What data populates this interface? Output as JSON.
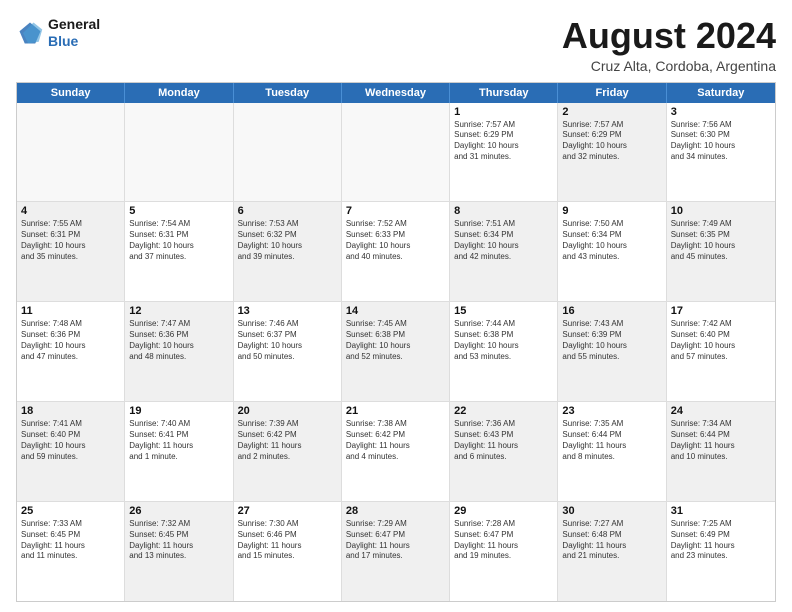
{
  "header": {
    "logo_line1": "General",
    "logo_line2": "Blue",
    "month_year": "August 2024",
    "location": "Cruz Alta, Cordoba, Argentina"
  },
  "weekdays": [
    "Sunday",
    "Monday",
    "Tuesday",
    "Wednesday",
    "Thursday",
    "Friday",
    "Saturday"
  ],
  "rows": [
    [
      {
        "day": "",
        "text": "",
        "shaded": false,
        "empty": true
      },
      {
        "day": "",
        "text": "",
        "shaded": false,
        "empty": true
      },
      {
        "day": "",
        "text": "",
        "shaded": false,
        "empty": true
      },
      {
        "day": "",
        "text": "",
        "shaded": false,
        "empty": true
      },
      {
        "day": "1",
        "text": "Sunrise: 7:57 AM\nSunset: 6:29 PM\nDaylight: 10 hours\nand 31 minutes.",
        "shaded": false,
        "empty": false
      },
      {
        "day": "2",
        "text": "Sunrise: 7:57 AM\nSunset: 6:29 PM\nDaylight: 10 hours\nand 32 minutes.",
        "shaded": true,
        "empty": false
      },
      {
        "day": "3",
        "text": "Sunrise: 7:56 AM\nSunset: 6:30 PM\nDaylight: 10 hours\nand 34 minutes.",
        "shaded": false,
        "empty": false
      }
    ],
    [
      {
        "day": "4",
        "text": "Sunrise: 7:55 AM\nSunset: 6:31 PM\nDaylight: 10 hours\nand 35 minutes.",
        "shaded": true,
        "empty": false
      },
      {
        "day": "5",
        "text": "Sunrise: 7:54 AM\nSunset: 6:31 PM\nDaylight: 10 hours\nand 37 minutes.",
        "shaded": false,
        "empty": false
      },
      {
        "day": "6",
        "text": "Sunrise: 7:53 AM\nSunset: 6:32 PM\nDaylight: 10 hours\nand 39 minutes.",
        "shaded": true,
        "empty": false
      },
      {
        "day": "7",
        "text": "Sunrise: 7:52 AM\nSunset: 6:33 PM\nDaylight: 10 hours\nand 40 minutes.",
        "shaded": false,
        "empty": false
      },
      {
        "day": "8",
        "text": "Sunrise: 7:51 AM\nSunset: 6:34 PM\nDaylight: 10 hours\nand 42 minutes.",
        "shaded": true,
        "empty": false
      },
      {
        "day": "9",
        "text": "Sunrise: 7:50 AM\nSunset: 6:34 PM\nDaylight: 10 hours\nand 43 minutes.",
        "shaded": false,
        "empty": false
      },
      {
        "day": "10",
        "text": "Sunrise: 7:49 AM\nSunset: 6:35 PM\nDaylight: 10 hours\nand 45 minutes.",
        "shaded": true,
        "empty": false
      }
    ],
    [
      {
        "day": "11",
        "text": "Sunrise: 7:48 AM\nSunset: 6:36 PM\nDaylight: 10 hours\nand 47 minutes.",
        "shaded": false,
        "empty": false
      },
      {
        "day": "12",
        "text": "Sunrise: 7:47 AM\nSunset: 6:36 PM\nDaylight: 10 hours\nand 48 minutes.",
        "shaded": true,
        "empty": false
      },
      {
        "day": "13",
        "text": "Sunrise: 7:46 AM\nSunset: 6:37 PM\nDaylight: 10 hours\nand 50 minutes.",
        "shaded": false,
        "empty": false
      },
      {
        "day": "14",
        "text": "Sunrise: 7:45 AM\nSunset: 6:38 PM\nDaylight: 10 hours\nand 52 minutes.",
        "shaded": true,
        "empty": false
      },
      {
        "day": "15",
        "text": "Sunrise: 7:44 AM\nSunset: 6:38 PM\nDaylight: 10 hours\nand 53 minutes.",
        "shaded": false,
        "empty": false
      },
      {
        "day": "16",
        "text": "Sunrise: 7:43 AM\nSunset: 6:39 PM\nDaylight: 10 hours\nand 55 minutes.",
        "shaded": true,
        "empty": false
      },
      {
        "day": "17",
        "text": "Sunrise: 7:42 AM\nSunset: 6:40 PM\nDaylight: 10 hours\nand 57 minutes.",
        "shaded": false,
        "empty": false
      }
    ],
    [
      {
        "day": "18",
        "text": "Sunrise: 7:41 AM\nSunset: 6:40 PM\nDaylight: 10 hours\nand 59 minutes.",
        "shaded": true,
        "empty": false
      },
      {
        "day": "19",
        "text": "Sunrise: 7:40 AM\nSunset: 6:41 PM\nDaylight: 11 hours\nand 1 minute.",
        "shaded": false,
        "empty": false
      },
      {
        "day": "20",
        "text": "Sunrise: 7:39 AM\nSunset: 6:42 PM\nDaylight: 11 hours\nand 2 minutes.",
        "shaded": true,
        "empty": false
      },
      {
        "day": "21",
        "text": "Sunrise: 7:38 AM\nSunset: 6:42 PM\nDaylight: 11 hours\nand 4 minutes.",
        "shaded": false,
        "empty": false
      },
      {
        "day": "22",
        "text": "Sunrise: 7:36 AM\nSunset: 6:43 PM\nDaylight: 11 hours\nand 6 minutes.",
        "shaded": true,
        "empty": false
      },
      {
        "day": "23",
        "text": "Sunrise: 7:35 AM\nSunset: 6:44 PM\nDaylight: 11 hours\nand 8 minutes.",
        "shaded": false,
        "empty": false
      },
      {
        "day": "24",
        "text": "Sunrise: 7:34 AM\nSunset: 6:44 PM\nDaylight: 11 hours\nand 10 minutes.",
        "shaded": true,
        "empty": false
      }
    ],
    [
      {
        "day": "25",
        "text": "Sunrise: 7:33 AM\nSunset: 6:45 PM\nDaylight: 11 hours\nand 11 minutes.",
        "shaded": false,
        "empty": false
      },
      {
        "day": "26",
        "text": "Sunrise: 7:32 AM\nSunset: 6:45 PM\nDaylight: 11 hours\nand 13 minutes.",
        "shaded": true,
        "empty": false
      },
      {
        "day": "27",
        "text": "Sunrise: 7:30 AM\nSunset: 6:46 PM\nDaylight: 11 hours\nand 15 minutes.",
        "shaded": false,
        "empty": false
      },
      {
        "day": "28",
        "text": "Sunrise: 7:29 AM\nSunset: 6:47 PM\nDaylight: 11 hours\nand 17 minutes.",
        "shaded": true,
        "empty": false
      },
      {
        "day": "29",
        "text": "Sunrise: 7:28 AM\nSunset: 6:47 PM\nDaylight: 11 hours\nand 19 minutes.",
        "shaded": false,
        "empty": false
      },
      {
        "day": "30",
        "text": "Sunrise: 7:27 AM\nSunset: 6:48 PM\nDaylight: 11 hours\nand 21 minutes.",
        "shaded": true,
        "empty": false
      },
      {
        "day": "31",
        "text": "Sunrise: 7:25 AM\nSunset: 6:49 PM\nDaylight: 11 hours\nand 23 minutes.",
        "shaded": false,
        "empty": false
      }
    ]
  ]
}
